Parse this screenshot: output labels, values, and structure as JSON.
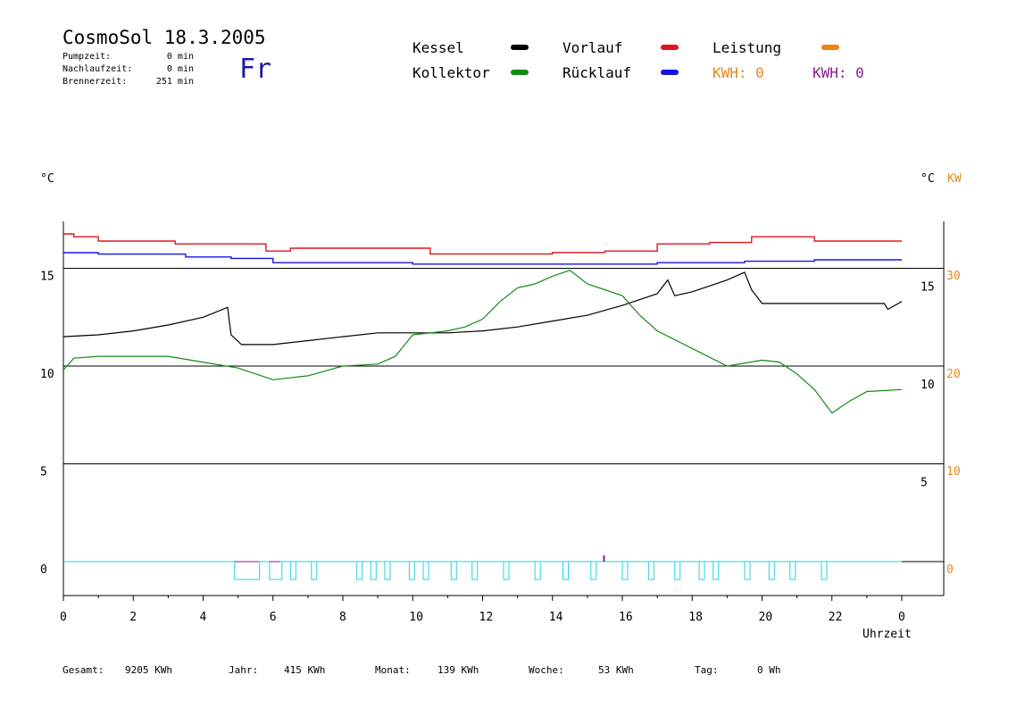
{
  "header": {
    "title": "CosmoSol 18.3.2005",
    "weekday": "Fr",
    "stats": [
      {
        "label": "Pumpzeit:",
        "value": "0 min"
      },
      {
        "label": "Nachlaufzeit:",
        "value": "0 min"
      },
      {
        "label": "Brennerzeit:",
        "value": "251 min"
      }
    ]
  },
  "legend": {
    "items": [
      {
        "label": "Kessel",
        "color": "#000000"
      },
      {
        "label": "Kollektor",
        "color": "#138a13"
      },
      {
        "label": "Vorlauf",
        "color": "#e0141e"
      },
      {
        "label": "Rücklauf",
        "color": "#1414e6"
      },
      {
        "label": "Leistung",
        "color": "#f08214"
      }
    ],
    "kwh_orange": "KWH: 0",
    "kwh_purple": "KWH: 0",
    "kwh_orange_color": "#e08a1e",
    "kwh_purple_color": "#8a1e8a"
  },
  "footer": [
    {
      "label": "Gesamt:",
      "value": "9205 KWh"
    },
    {
      "label": "Jahr:",
      "value": "415 KWh"
    },
    {
      "label": "Monat:",
      "value": "139 KWh"
    },
    {
      "label": "Woche:",
      "value": "53 KWh"
    },
    {
      "label": "Tag:",
      "value": "0 Wh"
    }
  ],
  "chart_data": {
    "type": "line",
    "xlabel": "Uhrzeit",
    "xlim": [
      0,
      24
    ],
    "x_ticks": [
      0,
      2,
      4,
      6,
      8,
      10,
      12,
      14,
      16,
      18,
      20,
      22,
      24
    ],
    "x_tick_labels": [
      "0",
      "2",
      "4",
      "6",
      "8",
      "10",
      "12",
      "14",
      "16",
      "18",
      "20",
      "22",
      "0"
    ],
    "y_left_label": "°C",
    "y_left_ticks": [
      0,
      5,
      10,
      15
    ],
    "y_left_range": [
      0,
      15
    ],
    "y_right_label": "°C",
    "y_right_ticks_c": [
      5,
      10,
      15
    ],
    "y_right_kw_label": "KW",
    "y_right_kw_ticks": [
      0,
      10,
      20,
      30
    ],
    "gridlines": [
      5,
      10,
      15
    ],
    "series": [
      {
        "name": "Vorlauf",
        "color": "#e0141e",
        "x": [
          0,
          0.3,
          1,
          3.2,
          5.8,
          6.5,
          9,
          10.5,
          12,
          14,
          15.5,
          17,
          18.5,
          19.7,
          21.5,
          24
        ],
        "y": [
          53,
          52.8,
          52.5,
          52.3,
          51.8,
          52,
          52,
          51.6,
          51.6,
          51.7,
          51.8,
          52.3,
          52.4,
          52.8,
          52.5,
          52.5
        ]
      },
      {
        "name": "Rücklauf",
        "color": "#1414e6",
        "x": [
          0,
          1,
          3.5,
          4.8,
          6,
          8,
          10,
          12,
          13.5,
          15,
          17,
          18.5,
          19.5,
          21.5,
          24
        ],
        "y": [
          51.6,
          51.5,
          51.3,
          51.2,
          50.9,
          50.9,
          50.8,
          50.8,
          50.8,
          50.8,
          50.9,
          50.9,
          51,
          51.1,
          51.1
        ]
      },
      {
        "name": "Kessel",
        "color": "#000000",
        "x": [
          0,
          1,
          2,
          3,
          4,
          4.7,
          4.8,
          5.1,
          6,
          7,
          8,
          9,
          10,
          11,
          12,
          13,
          14,
          15,
          16,
          17,
          17.3,
          17.5,
          18,
          19,
          19.5,
          19.7,
          20,
          22,
          23.5,
          23.6,
          23.9,
          24
        ],
        "y": [
          11.5,
          11.6,
          11.8,
          12.1,
          12.5,
          13.0,
          11.6,
          11.1,
          11.1,
          11.3,
          11.5,
          11.7,
          11.7,
          11.7,
          11.8,
          12.0,
          12.3,
          12.6,
          13.1,
          13.7,
          14.4,
          13.6,
          13.8,
          14.4,
          14.8,
          13.9,
          13.2,
          13.2,
          13.2,
          12.9,
          13.2,
          13.3
        ]
      },
      {
        "name": "Kollektor",
        "color": "#138a13",
        "x": [
          0,
          0.3,
          1,
          2,
          3,
          4,
          5,
          6,
          7,
          8,
          9,
          9.5,
          10,
          11,
          11.5,
          12,
          12.5,
          13,
          13.5,
          14,
          14.5,
          15,
          16,
          16.5,
          17,
          18,
          19,
          20,
          20.5,
          21,
          21.5,
          22,
          22.5,
          23,
          24
        ],
        "y": [
          9.8,
          10.4,
          10.5,
          10.5,
          10.5,
          10.2,
          9.9,
          9.3,
          9.5,
          10.0,
          10.1,
          10.5,
          11.6,
          11.8,
          12.0,
          12.4,
          13.3,
          14.0,
          14.2,
          14.6,
          14.9,
          14.2,
          13.6,
          12.6,
          11.8,
          10.9,
          10.0,
          10.3,
          10.2,
          9.6,
          8.8,
          7.6,
          8.2,
          8.7,
          8.8
        ]
      }
    ],
    "pump_markers_hours": [
      4.9,
      5.9,
      6.5,
      7.1,
      8.4,
      8.8,
      9.2,
      9.9,
      10.3,
      11.1,
      11.7,
      12.6,
      13.5,
      14.3,
      15.1,
      16.0,
      16.75,
      17.5,
      18.2,
      18.6,
      19.5,
      20.2,
      20.8,
      21.7
    ]
  }
}
